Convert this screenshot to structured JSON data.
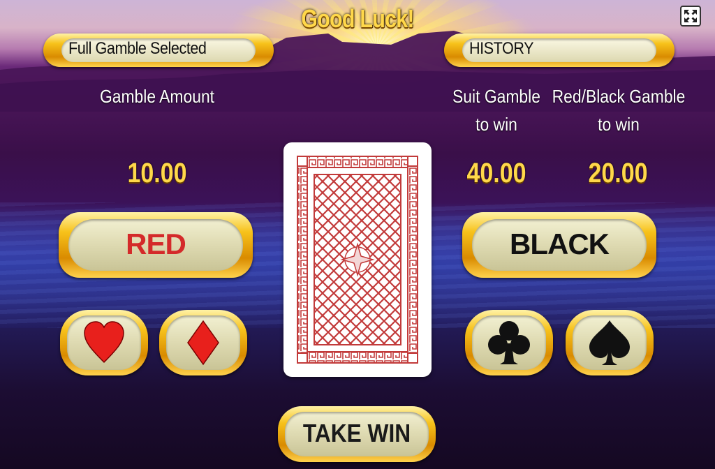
{
  "title": "Good Luck!",
  "selection_label": "Full Gamble Selected",
  "history_label": "HISTORY",
  "gamble_amount": {
    "label": "Gamble Amount",
    "value": "10.00"
  },
  "suit_gamble": {
    "label_line1": "Suit Gamble",
    "label_line2": "to win",
    "value": "40.00"
  },
  "redblack_gamble": {
    "label_line1": "Red/Black Gamble",
    "label_line2": "to win",
    "value": "20.00"
  },
  "buttons": {
    "red": "RED",
    "black": "BLACK",
    "take_win": "TAKE WIN",
    "suits": [
      "hearts-icon",
      "diamonds-icon",
      "clubs-icon",
      "spades-icon"
    ]
  },
  "colors": {
    "red": "#d42a2a",
    "gold": "#ffd84a",
    "card_pattern": "#c23a3a"
  }
}
